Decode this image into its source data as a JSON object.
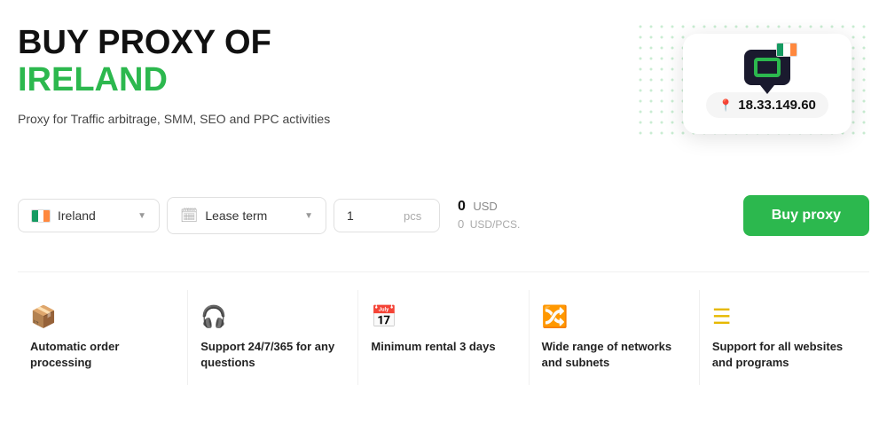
{
  "hero": {
    "title_line1": "BUY PROXY OF",
    "title_line2": "IRELAND",
    "subtitle": "Proxy for Traffic arbitrage, SMM, SEO and PPC activities",
    "card_ip": "18.33.149.60"
  },
  "controls": {
    "country_label": "Ireland",
    "lease_label": "Lease term",
    "qty_value": "1",
    "qty_unit": "pcs",
    "price_usd": "0",
    "price_currency": "USD",
    "price_per_pcs_value": "0",
    "price_per_pcs_label": "USD/PCS.",
    "buy_button_label": "Buy proxy"
  },
  "features": [
    {
      "icon": "📦",
      "text": "Automatic order processing"
    },
    {
      "icon": "🎧",
      "text": "Support 24/7/365 for any questions"
    },
    {
      "icon": "📅",
      "text": "Minimum rental 3 days"
    },
    {
      "icon": "🔀",
      "text": "Wide range of networks and subnets"
    },
    {
      "icon": "☰",
      "text": "Support for all websites and programs"
    }
  ]
}
